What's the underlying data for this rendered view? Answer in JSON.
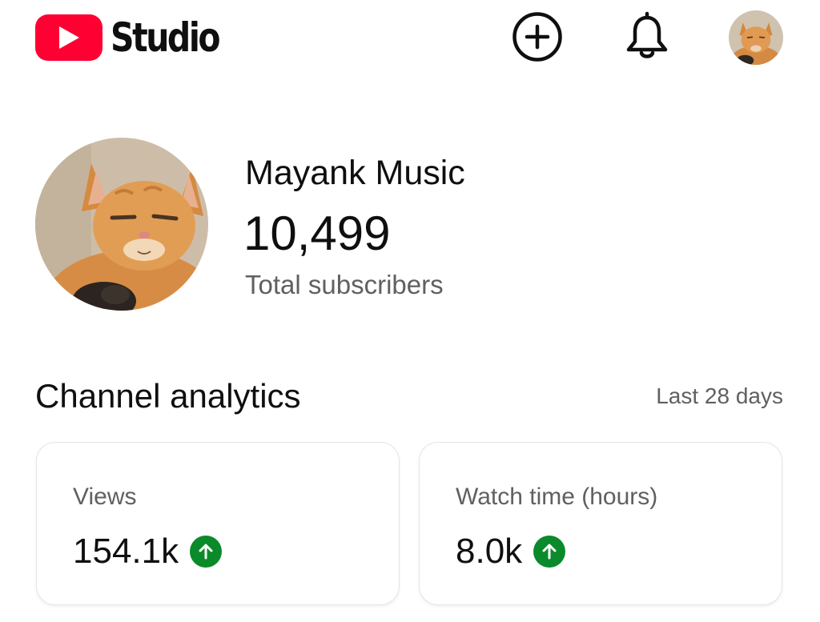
{
  "header": {
    "logo_text": "Studio",
    "create_icon": "add-circle-icon",
    "notifications_icon": "bell-icon",
    "account_icon": "avatar"
  },
  "channel": {
    "name": "Mayank Music",
    "subscriber_count": "10,499",
    "subscriber_label": "Total subscribers"
  },
  "analytics": {
    "title": "Channel analytics",
    "range": "Last 28 days",
    "cards": [
      {
        "label": "Views",
        "value": "154.1k",
        "trend": "up"
      },
      {
        "label": "Watch time (hours)",
        "value": "8.0k",
        "trend": "up"
      }
    ]
  },
  "colors": {
    "brand_red": "#ff0033",
    "trend_up_green": "#0a8a2a",
    "secondary_text": "#606060"
  }
}
